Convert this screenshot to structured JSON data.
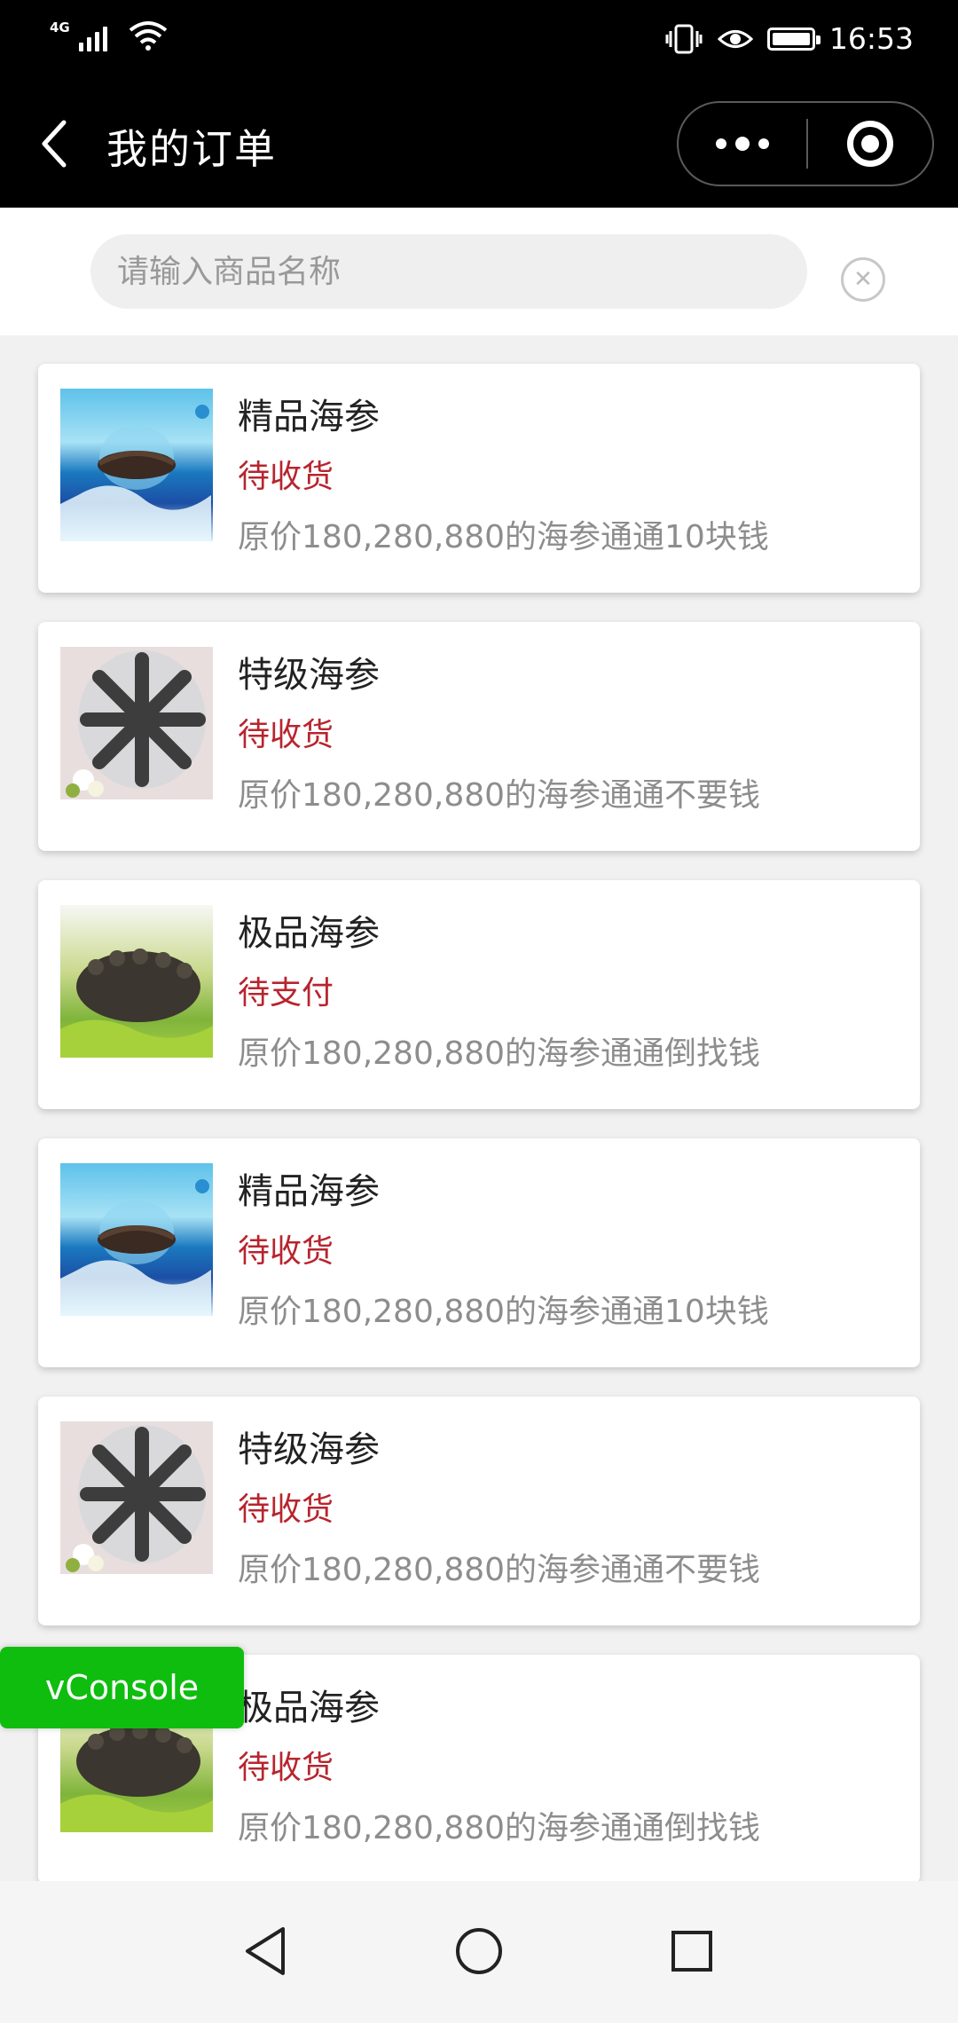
{
  "status_bar": {
    "network": "4G",
    "time": "16:53"
  },
  "nav": {
    "title": "我的订单"
  },
  "search": {
    "placeholder": "请输入商品名称"
  },
  "orders": [
    {
      "name": "精品海参",
      "status": "待收货",
      "desc": "原价180,280,880的海参通通10块钱",
      "image": "sea-cucumber-ocean"
    },
    {
      "name": "特级海参",
      "status": "待收货",
      "desc": "原价180,280,880的海参通通不要钱",
      "image": "sea-cucumber-plate"
    },
    {
      "name": "极品海参",
      "status": "待支付",
      "desc": "原价180,280,880的海参通通倒找钱",
      "image": "sea-cucumber-greens"
    },
    {
      "name": "精品海参",
      "status": "待收货",
      "desc": "原价180,280,880的海参通通10块钱",
      "image": "sea-cucumber-ocean"
    },
    {
      "name": "特级海参",
      "status": "待收货",
      "desc": "原价180,280,880的海参通通不要钱",
      "image": "sea-cucumber-plate"
    },
    {
      "name": "极品海参",
      "status": "待收货",
      "desc": "原价180,280,880的海参通通倒找钱",
      "image": "sea-cucumber-greens"
    }
  ],
  "vconsole": {
    "label": "vConsole"
  },
  "colors": {
    "status_red": "#b7252e",
    "vconsole_green": "#0fbd0f"
  },
  "icons": {
    "back": "chevron-left-icon",
    "more": "more-dots-icon",
    "close_app": "target-icon",
    "clear": "clear-x-icon",
    "sys_back": "triangle-back-icon",
    "sys_home": "circle-home-icon",
    "sys_recent": "square-recent-icon"
  }
}
